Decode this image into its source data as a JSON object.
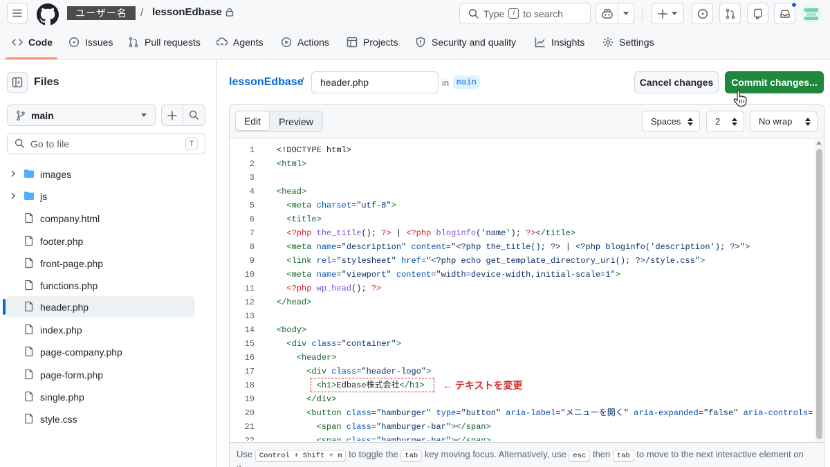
{
  "header": {
    "owner": "ユーザー名",
    "slash": "/",
    "repo": "lessonEdbase",
    "search_prefix": "Type",
    "search_key": "/",
    "search_suffix": "to search"
  },
  "nav": {
    "tabs": [
      {
        "label": "Code",
        "icon": "code-icon"
      },
      {
        "label": "Issues",
        "icon": "issue-icon"
      },
      {
        "label": "Pull requests",
        "icon": "pull-request-icon"
      },
      {
        "label": "Agents",
        "icon": "agents-icon"
      },
      {
        "label": "Actions",
        "icon": "play-icon"
      },
      {
        "label": "Projects",
        "icon": "table-icon"
      },
      {
        "label": "Security and quality",
        "icon": "shield-icon"
      },
      {
        "label": "Insights",
        "icon": "graph-icon"
      },
      {
        "label": "Settings",
        "icon": "gear-icon"
      }
    ]
  },
  "sidebar": {
    "title": "Files",
    "branch": "main",
    "goto_placeholder": "Go to file",
    "goto_key": "T",
    "tree": [
      {
        "name": "images",
        "type": "folder"
      },
      {
        "name": "js",
        "type": "folder"
      },
      {
        "name": "company.html",
        "type": "file"
      },
      {
        "name": "footer.php",
        "type": "file"
      },
      {
        "name": "front-page.php",
        "type": "file"
      },
      {
        "name": "functions.php",
        "type": "file"
      },
      {
        "name": "header.php",
        "type": "file",
        "selected": true
      },
      {
        "name": "index.php",
        "type": "file"
      },
      {
        "name": "page-company.php",
        "type": "file"
      },
      {
        "name": "page-form.php",
        "type": "file"
      },
      {
        "name": "single.php",
        "type": "file"
      },
      {
        "name": "style.css",
        "type": "file"
      }
    ]
  },
  "editor_header": {
    "repo_link": "lessonEdbase",
    "slash": "/",
    "filename": "header.php",
    "in_label": "in",
    "branch": "main",
    "cancel_label": "Cancel changes",
    "commit_label": "Commit changes..."
  },
  "editor": {
    "tab_edit": "Edit",
    "tab_preview": "Preview",
    "indent_mode": "Spaces",
    "indent_size": "2",
    "wrap_mode": "No wrap",
    "footer": {
      "t1": "Use",
      "k1": "Control + Shift + m",
      "t2": "to toggle the",
      "k2": "tab",
      "t3": "key moving focus. Alternatively, use",
      "k3": "esc",
      "t4": "then",
      "k4": "tab",
      "t5": "to move to the next interactive element on the page."
    }
  },
  "code_lines": [
    {
      "n": "1",
      "t": "<!DOCTYPE html>"
    },
    {
      "n": "2",
      "t": "<html>"
    },
    {
      "n": "3",
      "t": ""
    },
    {
      "n": "4",
      "t": "<head>"
    },
    {
      "n": "5",
      "t": "  <meta charset=\"utf-8\">"
    },
    {
      "n": "6",
      "t": "  <title>"
    },
    {
      "n": "7",
      "t": "  <?php the_title(); ?> | <?php bloginfo('name'); ?></title>"
    },
    {
      "n": "8",
      "t": "  <meta name=\"description\" content=\"<?php the_title(); ?> | <?php bloginfo('description'); ?>\">"
    },
    {
      "n": "9",
      "t": "  <link rel=\"stylesheet\" href=\"<?php echo get_template_directory_uri(); ?>/style.css\">"
    },
    {
      "n": "10",
      "t": "  <meta name=\"viewport\" content=\"width=device-width,initial-scale=1\">"
    },
    {
      "n": "11",
      "t": "  <?php wp_head(); ?>"
    },
    {
      "n": "12",
      "t": "</head>"
    },
    {
      "n": "13",
      "t": ""
    },
    {
      "n": "14",
      "t": "<body>"
    },
    {
      "n": "15",
      "t": "  <div class=\"container\">"
    },
    {
      "n": "16",
      "t": "    <header>"
    },
    {
      "n": "17",
      "t": "      <div class=\"header-logo\">"
    },
    {
      "n": "18",
      "t": "        <h1>Edbase株式会社</h1>"
    },
    {
      "n": "19",
      "t": "      </div>"
    },
    {
      "n": "20",
      "t": "      <button class=\"hamburger\" type=\"button\" aria-label=\"メニューを開く\" aria-expanded=\"false\" aria-controls=\"header-n"
    },
    {
      "n": "21",
      "t": "        <span class=\"hamburger-bar\"></span>"
    },
    {
      "n": "22",
      "t": "        <span class=\"hamburger-bar\"></span>"
    }
  ],
  "annotation": {
    "text": "← テキストを変更",
    "color": "#d62a2a"
  },
  "colors": {
    "accent": "#0969da",
    "commit_green": "#1f883d",
    "tab_underline": "#fd8c73"
  }
}
